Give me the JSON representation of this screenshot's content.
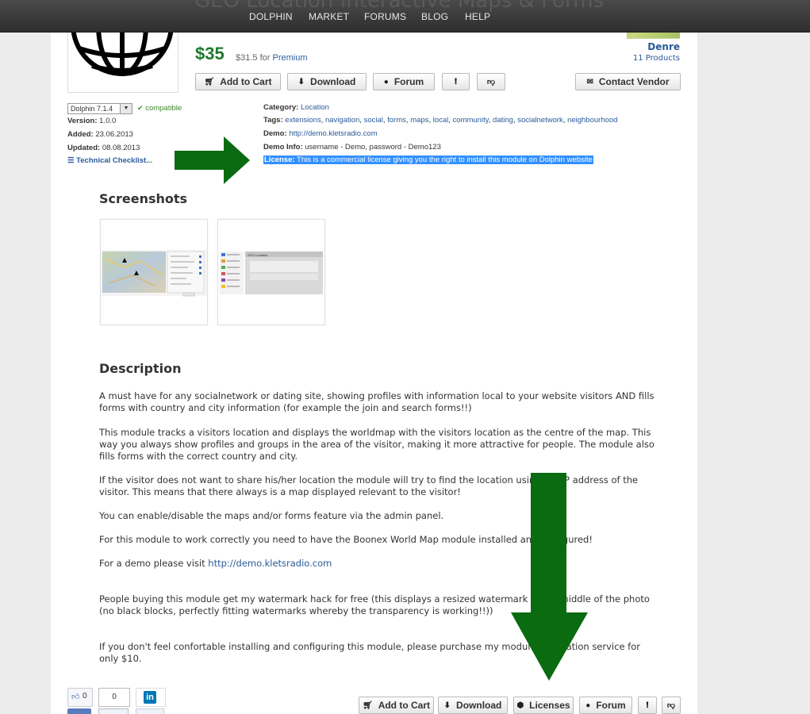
{
  "nav": {
    "ghost_title": "GEO Location Interactive Maps & Forms",
    "items": [
      "DOLPHIN",
      "MARKET",
      "FORUMS",
      "BLOG",
      "HELP"
    ]
  },
  "product": {
    "price": "$35",
    "premium_price": "$31.5",
    "premium_for": "for",
    "premium_label": "Premium"
  },
  "vendor": {
    "name": "Denre",
    "products": "11 Products"
  },
  "actions_top": {
    "add_to_cart": "Add to Cart",
    "download": "Download",
    "forum": "Forum",
    "contact_vendor": "Contact Vendor"
  },
  "meta_left": {
    "version_selected": "Dolphin 7.1.4",
    "compatible": "compatible",
    "version_label": "Version:",
    "version_value": "1.0.0",
    "added_label": "Added:",
    "added_value": "23.06.2013",
    "updated_label": "Updated:",
    "updated_value": "08.08.2013",
    "tech_checklist": "Technical Checklist..."
  },
  "meta_right": {
    "category_label": "Category:",
    "category_value": "Location",
    "tags_label": "Tags:",
    "tags": [
      "extensions",
      "navigation",
      "social",
      "forms",
      "maps",
      "local",
      "community",
      "dating",
      "socialnetwork",
      "neighbourhood"
    ],
    "demo_label": "Demo:",
    "demo_value": "http://demo.kletsradio.com",
    "demo_info_label": "Demo Info:",
    "demo_info_value": "username - Demo, password - Demo123",
    "license_label": "License:",
    "license_value": "This is a commercial license giving you the right to install this module on Dolphin website"
  },
  "screenshots": {
    "heading": "Screenshots",
    "shot2_title": "GEO Location"
  },
  "description": {
    "heading": "Description",
    "p1": "A must have for any socialnetwork or dating site, showing profiles with information local to your website visitors AND fills forms with country and city information (for example the join and search forms!!)",
    "p2": "This module tracks a visitors location and displays the worldmap with the visitors location as the centre of the map. This way you always show profiles and groups in the area of the visitor, making it more attractive for people. The module also fills forms with the correct country and city.",
    "p3": "If the visitor does not want to share his/her location the module will try to find the location using the IP address of the visitor. This means that there always is a map displayed relevant to the visitor!",
    "p4": "You can enable/disable the maps and/or forms feature via the admin panel.",
    "p5": "For this module to work correctly you need to have the Boonex World Map module installed and configured!",
    "p6_prefix": "For a demo please visit",
    "p6_link": "http://demo.kletsradio.com",
    "p7": "People buying this module get my watermark hack for free (this displays a resized watermark in the middle of the photo (no black blocks, perfectly fitting watermarks whereby the transparency is working!!))",
    "p8": "If you don't feel confortable installing and configuring this module, please purchase my module installation service for only $10."
  },
  "actions_bottom": {
    "add_to_cart": "Add to Cart",
    "download": "Download",
    "licenses": "Licenses",
    "forum": "Forum"
  },
  "social": {
    "like_count": "0",
    "share_count": "0",
    "linkedin": "in"
  },
  "colors": {
    "price_green": "#1e7a2c",
    "link_blue": "#2a5a9a",
    "highlight": "#3390ff",
    "arrow_green": "#0a6b10"
  }
}
